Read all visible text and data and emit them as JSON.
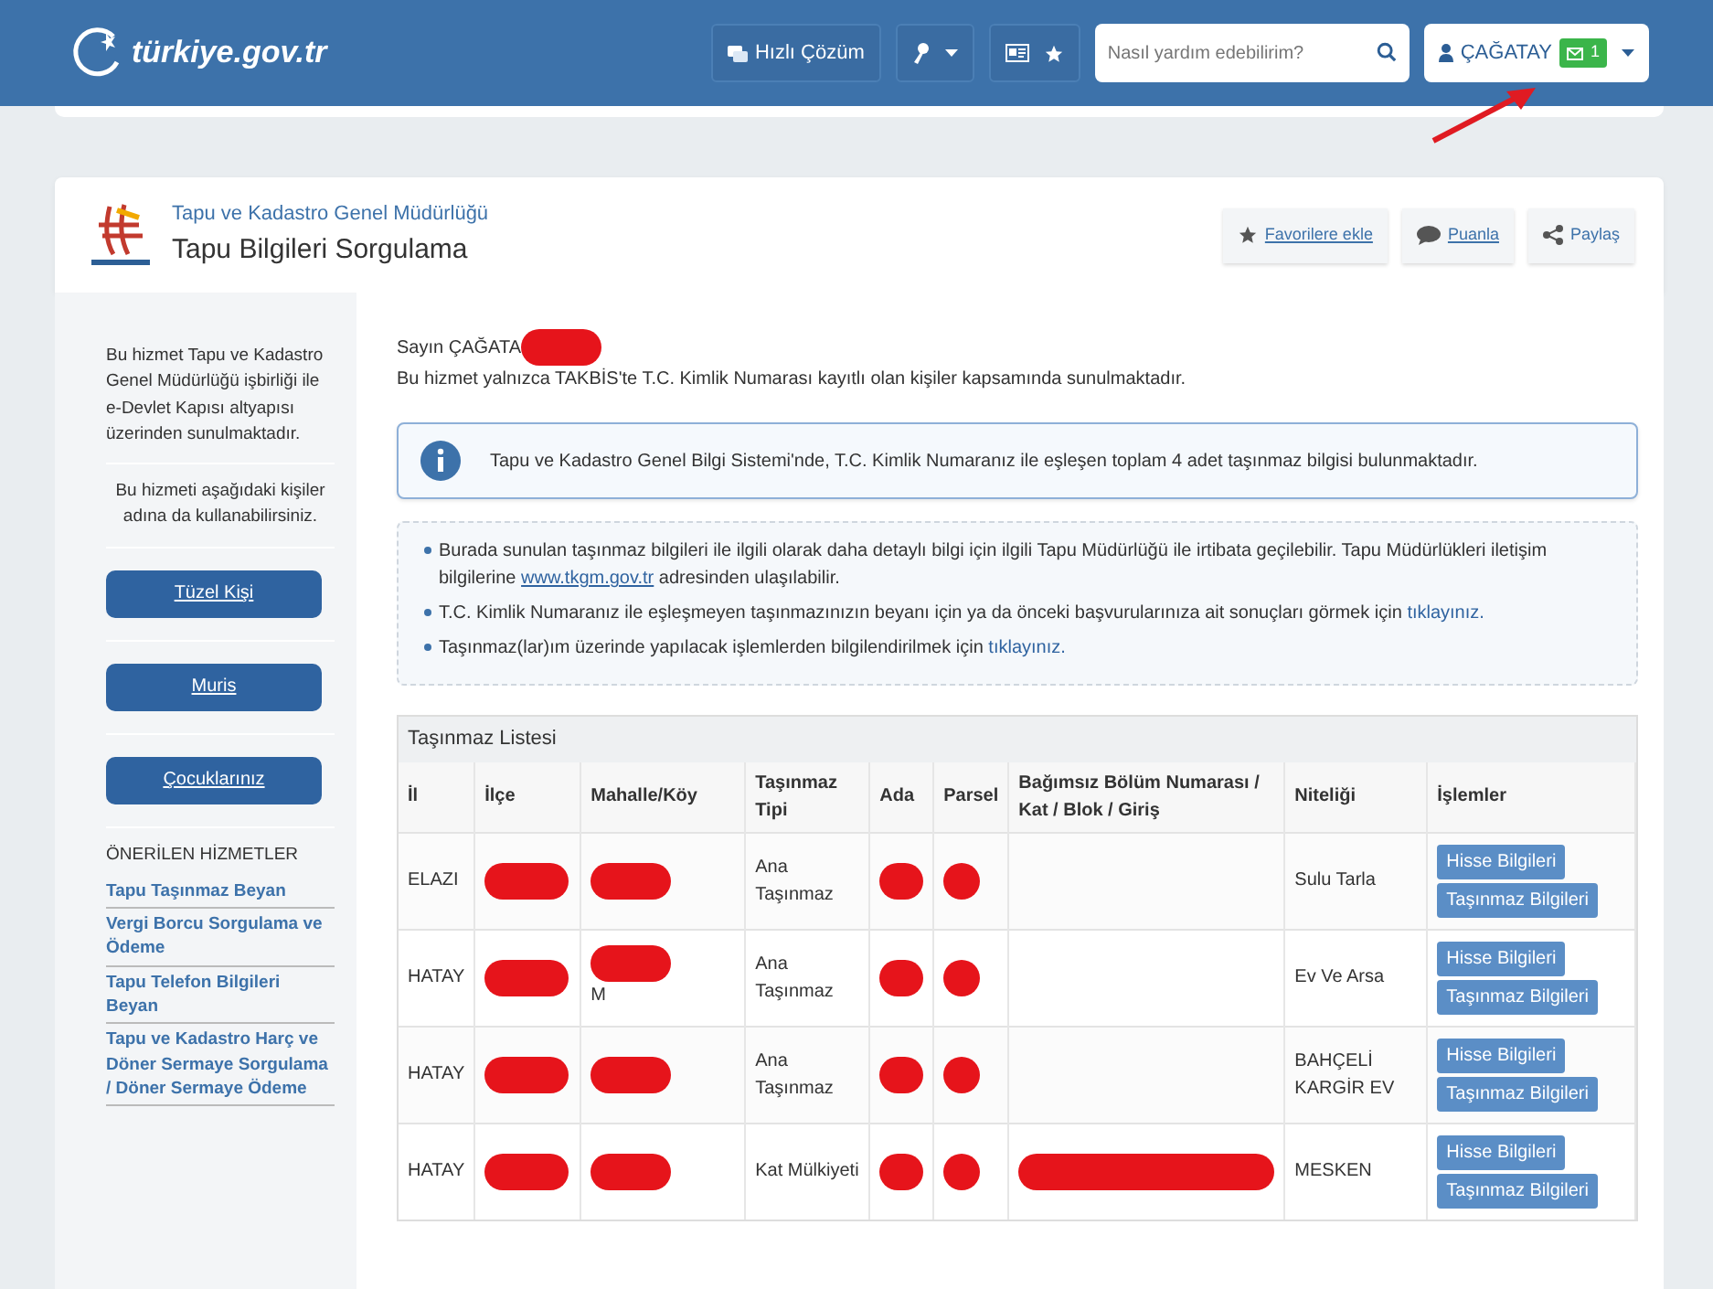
{
  "header": {
    "logo_text": "türkiye.gov.tr",
    "quick_solution": "Hızlı Çözüm",
    "search": {
      "placeholder": "Nasıl yardım edebilirim?"
    },
    "user": "ÇAĞATAY",
    "message_count": "1"
  },
  "service": {
    "organization": "Tapu ve Kadastro Genel Müdürlüğü",
    "title": "Tapu Bilgileri Sorgulama",
    "actions": [
      "Favorilere ekle",
      "Puanla",
      "Paylaş"
    ]
  },
  "sidebar": {
    "intro": "Bu hizmet Tapu ve Kadastro Genel Müdürlüğü işbirliği ile e-Devlet Kapısı altyapısı üzerinden sunulmaktadır.",
    "proxy_text": "Bu hizmeti aşağıdaki kişiler adına da kullanabilirsiniz.",
    "proxy_buttons": [
      "Tüzel Kişi",
      "Muris",
      "Çocuklarınız"
    ],
    "recommended_title": "ÖNERİLEN HİZMETLER",
    "recommended": [
      "Tapu Taşınmaz Beyan",
      "Vergi Borcu Sorgulama ve Ödeme",
      "Tapu Telefon Bilgileri Beyan",
      "Tapu ve Kadastro Harç ve Döner Sermaye Sorgulama / Döner Sermaye Ödeme"
    ]
  },
  "main": {
    "greeting": "Sayın ÇAĞATA",
    "greeting_redacted": true,
    "notice": "Bu hizmet yalnızca TAKBİS'te T.C. Kimlik Numarası kayıtlı olan kişiler kapsamında sunulmaktadır.",
    "info": "Tapu ve Kadastro Genel Bilgi Sistemi'nde, T.C. Kimlik Numaranız ile eşleşen toplam 4 adet taşınmaz bilgisi bulunmaktadır.",
    "bullets": [
      [
        {
          "text": "Burada sunulan taşınmaz bilgileri ile ilgili olarak daha detaylı bilgi için ilgili Tapu Müdürlüğü ile irtibata geçilebilir. Tapu Müdürlükleri iletişim bilgilerine ",
          "link": false
        },
        {
          "text": "www.tkgm.gov.tr",
          "link": true
        },
        {
          "text": " adresinden ulaşılabilir.",
          "link": false
        }
      ],
      [
        {
          "text": "T.C. Kimlik Numaranız ile eşleşmeyen taşınmazınızın beyanı için ya da önceki başvurularınıza ait sonuçları görmek için ",
          "link": false
        },
        {
          "text": "tıklayınız.",
          "link": true
        }
      ],
      [
        {
          "text": "Taşınmaz(lar)ım üzerinde yapılacak işlemlerden bilgilendirilmek için ",
          "link": false
        },
        {
          "text": "tıklayınız.",
          "link": true
        }
      ]
    ]
  },
  "table": {
    "caption": "Taşınmaz Listesi",
    "columns": [
      "İl",
      "İlçe",
      "Mahalle/Köy",
      "Taşınmaz Tipi",
      "Ada",
      "Parsel",
      "Bağımsız Bölüm Numarası / Kat / Blok / Giriş",
      "Niteliği",
      "İşlemler"
    ],
    "rows": [
      {
        "cells": [
          {
            "text": "ELAZI",
            "redacted": false
          },
          {
            "redacted": true
          },
          {
            "redacted": true
          },
          {
            "text": "Ana Taşınmaz",
            "redacted": false
          },
          {
            "redacted": true
          },
          {
            "redacted": true
          },
          {
            "redacted": false
          },
          {
            "text": "Sulu Tarla",
            "redacted": false
          }
        ],
        "actions": [
          "Hisse Bilgileri",
          "Taşınmaz Bilgileri"
        ]
      },
      {
        "cells": [
          {
            "text": "HATAY",
            "redacted": false
          },
          {
            "redacted": true
          },
          {
            "text": "M",
            "redacted": true
          },
          {
            "text": "Ana Taşınmaz",
            "redacted": false
          },
          {
            "redacted": true
          },
          {
            "redacted": true
          },
          {
            "redacted": false
          },
          {
            "text": "Ev Ve Arsa",
            "redacted": false
          }
        ],
        "actions": [
          "Hisse Bilgileri",
          "Taşınmaz Bilgileri"
        ]
      },
      {
        "cells": [
          {
            "text": "HATAY",
            "redacted": false
          },
          {
            "redacted": true
          },
          {
            "redacted": true
          },
          {
            "text": "Ana Taşınmaz",
            "redacted": false
          },
          {
            "redacted": true
          },
          {
            "redacted": true
          },
          {
            "redacted": false
          },
          {
            "text": "BAHÇELİ KARGİR EV",
            "redacted": false
          }
        ],
        "actions": [
          "Hisse Bilgileri",
          "Taşınmaz Bilgileri"
        ]
      },
      {
        "cells": [
          {
            "text": "HATAY",
            "redacted": false
          },
          {
            "redacted": true
          },
          {
            "redacted": true
          },
          {
            "text": "Kat Mülkiyeti",
            "redacted": false
          },
          {
            "redacted": true
          },
          {
            "redacted": true
          },
          {
            "redacted": true
          },
          {
            "text": "MESKEN",
            "redacted": false
          }
        ],
        "actions": [
          "Hisse Bilgileri",
          "Taşınmaz Bilgileri"
        ]
      }
    ]
  }
}
